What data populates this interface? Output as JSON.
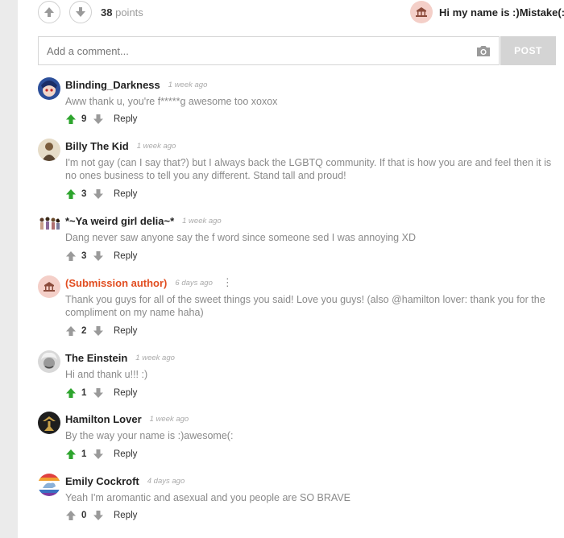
{
  "post": {
    "points": "38",
    "points_label": "points",
    "author_name": "Hi my name is :)Mistake(:"
  },
  "comment_form": {
    "placeholder": "Add a comment...",
    "post_label": "POST"
  },
  "comments": [
    {
      "name": "Blinding_Darkness",
      "time": "1 week ago",
      "text": "Aww thank u, you're f*****g awesome too xoxox",
      "votes": "9",
      "voted_up": true,
      "reply": "Reply"
    },
    {
      "name": "Billy The Kid",
      "time": "1 week ago",
      "text": "I'm not gay (can I say that?) but I always back the LGBTQ community. If that is how you are and feel then it is no ones business to tell you any different. Stand tall and proud!",
      "votes": "3",
      "voted_up": true,
      "reply": "Reply"
    },
    {
      "name": "*~Ya weird girl delia~*",
      "time": "1 week ago",
      "text": "Dang never saw anyone say the f word since someone sed I was annoying XD",
      "votes": "3",
      "voted_up": false,
      "reply": "Reply"
    },
    {
      "name": "(Submission author)",
      "time": "6 days ago",
      "text": "Thank you guys for all of the sweet things you said! Love you guys! (also @hamilton lover: thank you for the compliment on my name haha)",
      "votes": "2",
      "voted_up": false,
      "reply": "Reply",
      "is_author": true
    },
    {
      "name": "The Einstein",
      "time": "1 week ago",
      "text": "Hi and thank u!!! :)",
      "votes": "1",
      "voted_up": true,
      "reply": "Reply"
    },
    {
      "name": "Hamilton Lover",
      "time": "1 week ago",
      "text": "By the way your name is :)awesome(:",
      "votes": "1",
      "voted_up": true,
      "reply": "Reply"
    },
    {
      "name": "Emily Cockroft",
      "time": "4 days ago",
      "text": "Yeah I'm aromantic and asexual and you people are SO BRAVE",
      "votes": "0",
      "voted_up": false,
      "reply": "Reply"
    }
  ],
  "colors": {
    "author_name": "#e14d20",
    "upvote_active": "#2ea52e",
    "inactive_arrow": "#9a9a9a",
    "post_button": "#d4d4d4"
  }
}
